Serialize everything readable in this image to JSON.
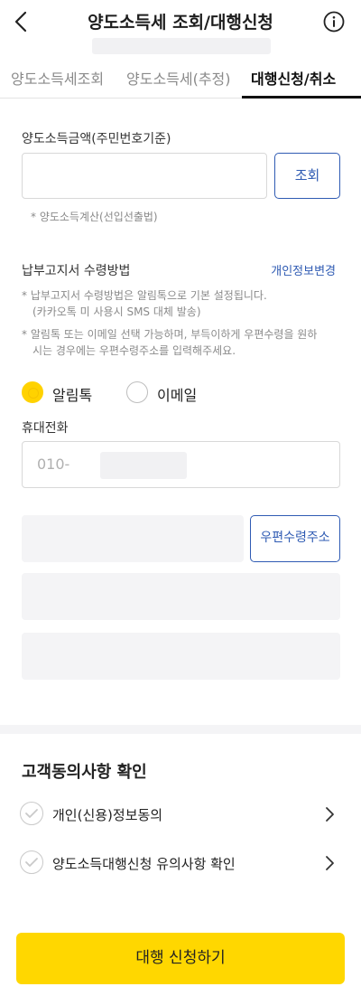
{
  "header": {
    "title": "양도소득세 조회/대행신청",
    "back_icon": "chevron-left-icon",
    "info_icon": "info-icon"
  },
  "tabs": [
    {
      "label": "양도소득세조회",
      "active": false
    },
    {
      "label": "양도소득세(추정)",
      "active": false
    },
    {
      "label": "대행신청/취소",
      "active": true
    }
  ],
  "lookup": {
    "label": "양도소득금액(주민번호기준)",
    "input_value": "",
    "button_label": "조회",
    "note": "* 양도소득계산(선입선출법)"
  },
  "delivery": {
    "label": "납부고지서 수령방법",
    "change_link": "개인정보변경",
    "note1_line1": "* 납부고지서 수령방법은 알림톡으로 기본 설정됩니다.",
    "note1_line2": "(카카오톡 미 사용시 SMS 대체 발송)",
    "note2_line1": "* 알림톡 또는 이메일 선택 가능하며, 부득이하게 우편수령을 원하",
    "note2_line2": "시는 경우에는 우편수령주소를 입력해주세요.",
    "options": [
      {
        "label": "알림톡",
        "selected": true
      },
      {
        "label": "이메일",
        "selected": false
      }
    ],
    "phone_label": "휴대전화",
    "phone_value": "010-",
    "zip_button": "우편수령주소"
  },
  "consent": {
    "title": "고객동의사항 확인",
    "items": [
      {
        "label": "개인(신용)정보동의",
        "checked": false
      },
      {
        "label": "양도소득대행신청 유의사항 확인",
        "checked": false
      }
    ]
  },
  "submit_label": "대행 신청하기",
  "colors": {
    "accent_yellow": "#ffd700",
    "link_blue": "#2f5bb3",
    "muted_gray": "#8a8a8a"
  }
}
